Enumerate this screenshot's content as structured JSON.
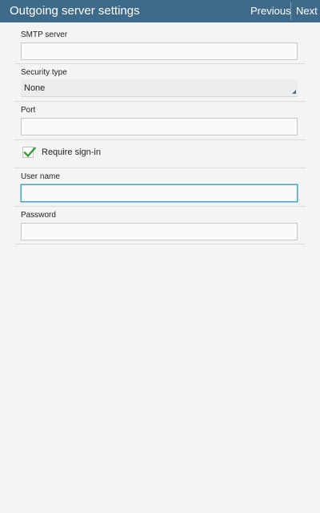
{
  "header": {
    "title": "Outgoing server settings",
    "previous_label": "Previous",
    "next_label": "Next"
  },
  "form": {
    "smtp_server": {
      "label": "SMTP server",
      "value": ""
    },
    "security_type": {
      "label": "Security type",
      "selected": "None"
    },
    "port": {
      "label": "Port",
      "value": ""
    },
    "require_signin": {
      "label": "Require sign-in",
      "checked": true
    },
    "user_name": {
      "label": "User name",
      "value": ""
    },
    "password": {
      "label": "Password",
      "value": ""
    }
  },
  "colors": {
    "header_bg": "#3f6b8a",
    "focus_border": "#3fa3d6",
    "check_green": "#3a9a3a"
  },
  "icons": {
    "checkbox_mark": "checkmark-icon",
    "dropdown_indicator": "dropdown-corner-icon"
  }
}
